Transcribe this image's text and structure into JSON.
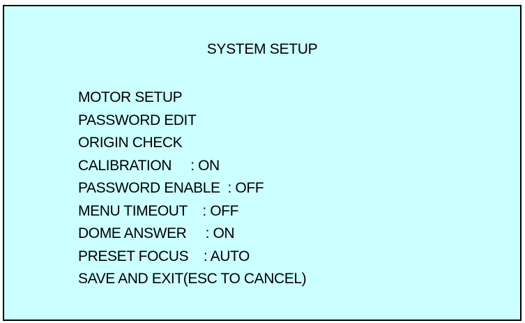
{
  "screen": {
    "title": "SYSTEM SETUP",
    "background_color": "#ccffff",
    "text_color": "#000000"
  },
  "menu": {
    "items": [
      {
        "label": "MOTOR SETUP"
      },
      {
        "label": "PASSWORD EDIT"
      },
      {
        "label": "ORIGIN CHECK"
      },
      {
        "label": "CALIBRATION     : ON"
      },
      {
        "label": "PASSWORD ENABLE  : OFF"
      },
      {
        "label": "MENU TIMEOUT    : OFF"
      },
      {
        "label": "DOME ANSWER     : ON"
      },
      {
        "label": "PRESET FOCUS    : AUTO"
      },
      {
        "label": "SAVE AND EXIT(ESC TO CANCEL)"
      }
    ]
  }
}
